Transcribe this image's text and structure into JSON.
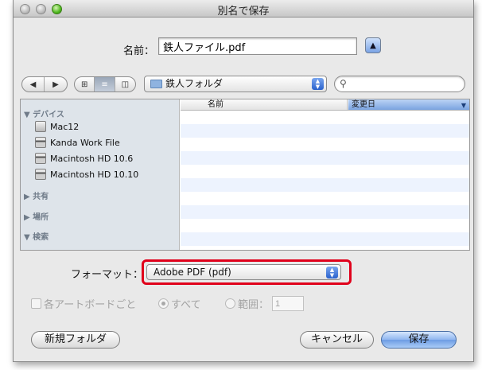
{
  "window": {
    "title": "別名で保存"
  },
  "name_row": {
    "label": "名前：",
    "value": "鉄人ファイル.pdf",
    "collapse_icon": "triangle-up-icon"
  },
  "toolbar": {
    "back_icon": "◀",
    "forward_icon": "▶",
    "view_icons": [
      "⊞",
      "≡",
      "◫"
    ],
    "active_view_index": 1,
    "folder": "鉄人フォルダ",
    "search_placeholder": "",
    "search_icon": "🔍"
  },
  "sidebar": {
    "groups": [
      {
        "label": "▼ デバイス"
      },
      {
        "label": "▶ 共有"
      },
      {
        "label": "▶ 場所"
      },
      {
        "label": "▼ 検索"
      }
    ],
    "devices": [
      {
        "label": "Mac12"
      },
      {
        "label": "Kanda Work File"
      },
      {
        "label": "Macintosh HD 10.6"
      },
      {
        "label": "Macintosh HD 10.10"
      }
    ]
  },
  "file_list": {
    "columns": [
      "名前",
      "変更日"
    ],
    "sort_icon": "▼"
  },
  "format": {
    "label": "フォーマット：",
    "value": "Adobe PDF (pdf)"
  },
  "options": {
    "each_artboard": "各アートボードごと",
    "all": "すべて",
    "range": "範囲：",
    "range_value": "1"
  },
  "buttons": {
    "new_folder": "新規フォルダ",
    "cancel": "キャンセル",
    "save": "保存"
  },
  "colors": {
    "highlight": "#e0001b",
    "accent": "#6d9ce4"
  }
}
